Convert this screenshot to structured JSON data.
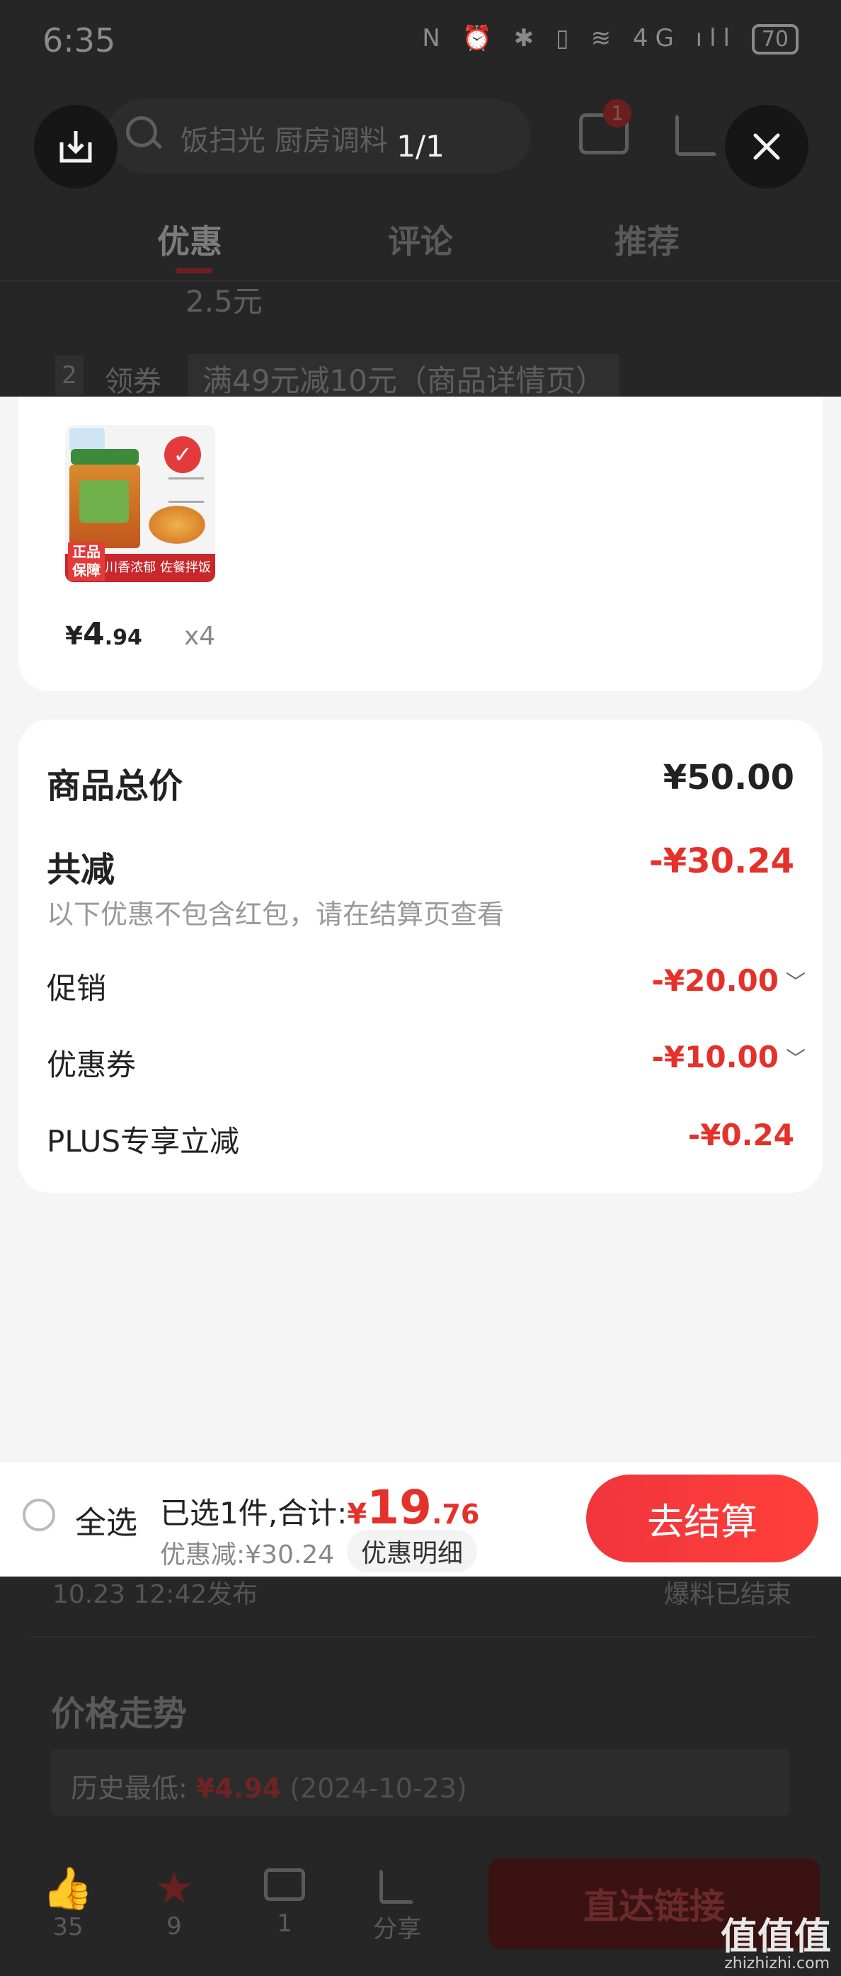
{
  "status_bar": {
    "time": "6:35",
    "icons": "N ⏰ ✱ ▯ ≋ 4G ıll",
    "battery": "70"
  },
  "viewer": {
    "counter": "1/1"
  },
  "background_page": {
    "search_text": "饭扫光 厨房调料",
    "message_badge": "1",
    "tabs": [
      "优惠",
      "评论",
      "推荐"
    ],
    "partial_text": "2.5元",
    "step_number": "2",
    "step_label": "领券",
    "step_detail": "满49元减10元（商品详情页）",
    "publish_time": "10.23 12:42发布",
    "status_text": "爆料已结束",
    "trend_title": "价格走势",
    "history_label": "历史最低:",
    "history_price": "¥4.94",
    "history_date": "(2024-10-23)",
    "actions": [
      {
        "icon": "thumbs-up-icon",
        "count": "35"
      },
      {
        "icon": "star-icon",
        "count": "9"
      },
      {
        "icon": "comment-icon",
        "count": "1"
      },
      {
        "icon": "share-icon",
        "count": "分享"
      }
    ],
    "direct_link": "直达链接",
    "watermark_main": "值值值",
    "watermark_sub": "zhizhizhi.com"
  },
  "product": {
    "image_badge": "正品保障",
    "image_caption": "川香浓郁 佐餐拌饭",
    "price_symbol": "¥",
    "price_int": "4",
    "price_dec": ".94",
    "quantity": "x4"
  },
  "summary": {
    "total_label": "商品总价",
    "total_value": "¥50.00",
    "discount_label": "共减",
    "discount_value": "-¥30.24",
    "note": "以下优惠不包含红包，请在结算页查看",
    "rows": [
      {
        "label": "促销",
        "value": "-¥20.00",
        "chevron": "﹀"
      },
      {
        "label": "优惠券",
        "value": "-¥10.00",
        "chevron": "﹀"
      },
      {
        "label": "PLUS专享立减",
        "value": "-¥0.24",
        "chevron": ""
      }
    ]
  },
  "checkout_bar": {
    "select_all": "全选",
    "selected_text": "已选1件,合计:",
    "total_symbol": "¥",
    "total_int": "19",
    "total_dec": ".76",
    "saved_text": "优惠减:¥30.24",
    "detail_chip": "优惠明细",
    "checkout_button": "去结算"
  },
  "colors": {
    "accent_red": "#e4322b",
    "checkout_gradient": "#f0353d"
  }
}
